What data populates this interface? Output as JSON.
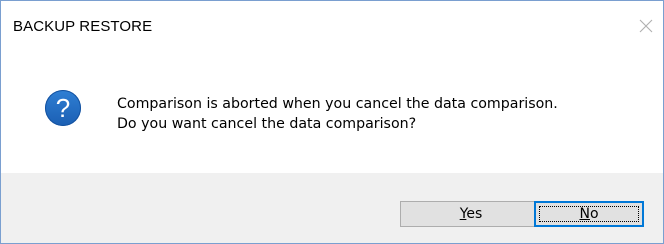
{
  "window": {
    "title": "BACKUP RESTORE"
  },
  "message": {
    "line1": "Comparison is aborted when you cancel the data comparison.",
    "line2": "Do you want cancel the data comparison?"
  },
  "icon": {
    "name": "question-icon",
    "glyph": "?",
    "color": "#1f6ac0"
  },
  "buttons": {
    "yes": {
      "accel": "Y",
      "rest": "es"
    },
    "no": {
      "accel": "N",
      "rest": "o"
    }
  },
  "colors": {
    "accent": "#0078d7",
    "footer_bg": "#f0f0f0"
  }
}
